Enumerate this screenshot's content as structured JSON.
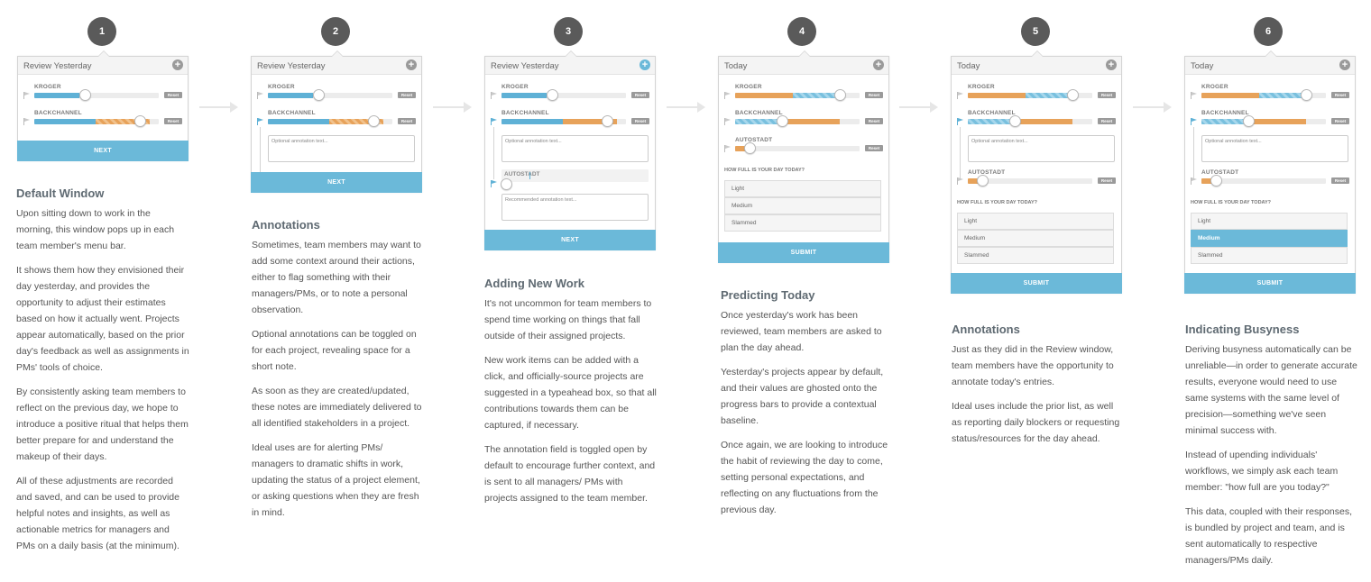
{
  "steps": [
    {
      "number": "1",
      "panel": {
        "title": "Review Yesterday",
        "projects": [
          "KROGER",
          "BACKCHANNEL"
        ],
        "reset_label": "Reset",
        "button": "NEXT"
      },
      "heading": "Default Window",
      "paragraphs": [
        "Upon sitting down to work in the morning, this window pops up in each team member's menu bar.",
        "It shows them how they envisioned their day yesterday, and provides the opportunity to adjust their estimates based on how it actually went. Projects appear automatically, based on the prior day's feedback as well as assignments in PMs' tools of choice.",
        "By consistently asking team members to reflect on the previous day, we hope to introduce a positive ritual that helps them better prepare for and understand the makeup of their days.",
        "All of these adjustments are recorded and saved, and can be used to provide helpful notes and insights, as well as actionable metrics for managers and PMs on a daily basis (at the minimum)."
      ]
    },
    {
      "number": "2",
      "panel": {
        "title": "Review Yesterday",
        "projects": [
          "KROGER",
          "BACKCHANNEL"
        ],
        "reset_label": "Reset",
        "annotation_placeholder": "Optional annotation text...",
        "button": "NEXT"
      },
      "heading": "Annotations",
      "paragraphs": [
        "Sometimes, team members may want to add some context around their actions, either to flag something with their managers/PMs, or to note a personal observation.",
        "Optional annotations can be toggled on for each project, revealing space for a short note.",
        "As soon as they are created/updated, these notes are immediately delivered to all identified stakeholders in a project.",
        "Ideal uses are for alerting PMs/ managers to dramatic shifts in work, updating the status of a project element, or asking questions when they are fresh in mind."
      ]
    },
    {
      "number": "3",
      "panel": {
        "title": "Review Yesterday",
        "projects": [
          "KROGER",
          "BACKCHANNEL"
        ],
        "reset_label": "Reset",
        "annotation_placeholder": "Optional annotation text...",
        "new_item": "AUTOSTADT",
        "recommended_placeholder": "Recommended annotation text...",
        "button": "NEXT"
      },
      "heading": "Adding New Work",
      "paragraphs": [
        "It's not uncommon for team members to spend time working on things that fall outside of their assigned projects.",
        "New work items can be added with a click, and officially-source projects are suggested in a typeahead box, so that all contributions towards them can be captured, if necessary.",
        "The annotation field is toggled open by default to encourage further context, and is sent to all managers/ PMs with projects assigned to the team member."
      ]
    },
    {
      "number": "4",
      "panel": {
        "title": "Today",
        "projects": [
          "KROGER",
          "BACKCHANNEL",
          "AUTOSTADT"
        ],
        "reset_label": "Reset",
        "question": "HOW FULL IS YOUR DAY TODAY?",
        "options": [
          "Light",
          "Medium",
          "Slammed"
        ],
        "button": "SUBMIT"
      },
      "heading": "Predicting Today",
      "paragraphs": [
        "Once yesterday's work has been reviewed, team members are asked to plan the day ahead.",
        "Yesterday's projects appear by default, and their values are ghosted onto the progress bars to provide a contextual baseline.",
        "Once again, we are looking to introduce the habit of reviewing the day to come, setting personal expectations, and reflecting on any fluctuations from the previous day."
      ]
    },
    {
      "number": "5",
      "panel": {
        "title": "Today",
        "projects": [
          "KROGER",
          "BACKCHANNEL",
          "AUTOSTADT"
        ],
        "reset_label": "Reset",
        "annotation_placeholder": "Optional annotation text...",
        "question": "HOW FULL IS YOUR DAY TODAY?",
        "options": [
          "Light",
          "Medium",
          "Slammed"
        ],
        "button": "SUBMIT"
      },
      "heading": "Annotations",
      "paragraphs": [
        "Just as they did in the Review window, team members have the opportunity to annotate today's entries.",
        "Ideal uses include the prior list, as well as reporting daily blockers or requesting status/resources for the day ahead."
      ]
    },
    {
      "number": "6",
      "panel": {
        "title": "Today",
        "projects": [
          "KROGER",
          "BACKCHANNEL",
          "AUTOSTADT"
        ],
        "reset_label": "Reset",
        "annotation_placeholder": "Optional annotation text...",
        "question": "HOW FULL IS YOUR DAY TODAY?",
        "options": [
          "Light",
          "Medium",
          "Slammed"
        ],
        "selected_option": "Medium",
        "button": "SUBMIT"
      },
      "heading": "Indicating Busyness",
      "paragraphs": [
        "Deriving busyness automatically can be unreliable—in order to generate accurate results,  everyone would need to use same systems with the same level of precision—something we've seen minimal success with.",
        "Instead of upending individuals' workflows, we simply ask each team member: \"how full are you today?\"",
        "This data, coupled with their responses, is bundled by project and team, and is sent automatically to respective managers/PMs daily."
      ]
    }
  ]
}
